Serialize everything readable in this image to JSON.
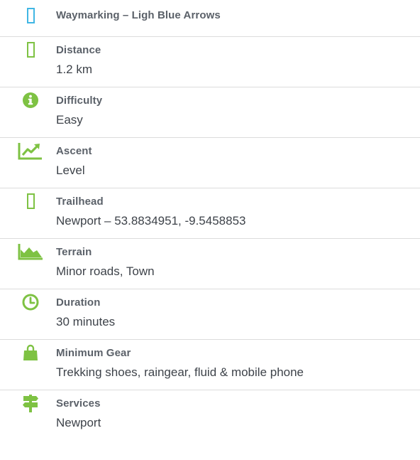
{
  "accent_green": "#7ec243",
  "accent_blue": "#40b6e4",
  "items": [
    {
      "icon": "waymarking-icon",
      "title": "Waymarking – Ligh Blue Arrows",
      "value": ""
    },
    {
      "icon": "distance-icon",
      "title": "Distance",
      "value": "1.2 km"
    },
    {
      "icon": "info-icon",
      "title": "Difficulty",
      "value": "Easy"
    },
    {
      "icon": "ascent-chart-icon",
      "title": "Ascent",
      "value": "Level"
    },
    {
      "icon": "trailhead-icon",
      "title": "Trailhead",
      "value": "Newport – 53.8834951, -9.5458853"
    },
    {
      "icon": "terrain-mountain-icon",
      "title": "Terrain",
      "value": "Minor roads, Town"
    },
    {
      "icon": "clock-icon",
      "title": "Duration",
      "value": "30 minutes"
    },
    {
      "icon": "shopping-bag-icon",
      "title": "Minimum Gear",
      "value": "Trekking shoes, raingear, fluid & mobile phone"
    },
    {
      "icon": "signpost-icon",
      "title": "Services",
      "value": "Newport"
    }
  ]
}
